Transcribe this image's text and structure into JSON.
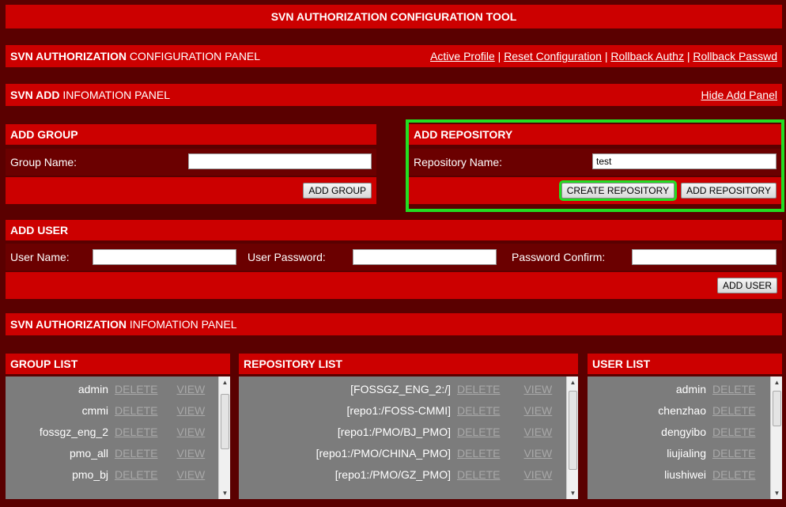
{
  "title": "SVN AUTHORIZATION CONFIGURATION TOOL",
  "config_panel": {
    "title_bold": "SVN AUTHORIZATION",
    "title_rest": " CONFIGURATION PANEL",
    "links": [
      "Active Profile",
      "Reset Configuration",
      "Rollback Authz",
      "Rollback Passwd"
    ],
    "separator": "|"
  },
  "add_panel": {
    "title_bold": "SVN ADD",
    "title_rest": " INFOMATION PANEL",
    "hide_link": "Hide Add Panel"
  },
  "add_group": {
    "heading": "ADD GROUP",
    "label": "Group Name:",
    "value": "",
    "button": "ADD GROUP"
  },
  "add_repository": {
    "heading": "ADD REPOSITORY",
    "label": "Repository Name:",
    "value": "test",
    "create_button": "CREATE REPOSITORY",
    "add_button": "ADD REPOSITORY"
  },
  "add_user": {
    "heading": "ADD USER",
    "user_label": "User Name:",
    "password_label": "User Password:",
    "confirm_label": "Password Confirm:",
    "button": "ADD USER"
  },
  "auth_panel": {
    "title_bold": "SVN AUTHORIZATION",
    "title_rest": " INFOMATION PANEL"
  },
  "group_list": {
    "heading": "GROUP LIST",
    "delete": "DELETE",
    "view": "VIEW",
    "items": [
      "admin",
      "cmmi",
      "fossgz_eng_2",
      "pmo_all",
      "pmo_bj"
    ]
  },
  "repository_list": {
    "heading": "REPOSITORY LIST",
    "delete": "DELETE",
    "view": "VIEW",
    "items": [
      "[FOSSGZ_ENG_2:/]",
      "[repo1:/FOSS-CMMI]",
      "[repo1:/PMO/BJ_PMO]",
      "[repo1:/PMO/CHINA_PMO]",
      "[repo1:/PMO/GZ_PMO]"
    ]
  },
  "user_list": {
    "heading": "USER LIST",
    "delete": "DELETE",
    "items": [
      "admin",
      "chenzhao",
      "dengyibo",
      "liujialing",
      "liushiwei"
    ]
  },
  "colors": {
    "panel_red": "#cc0000",
    "background": "#5a0000",
    "highlight": "#22dd22"
  }
}
